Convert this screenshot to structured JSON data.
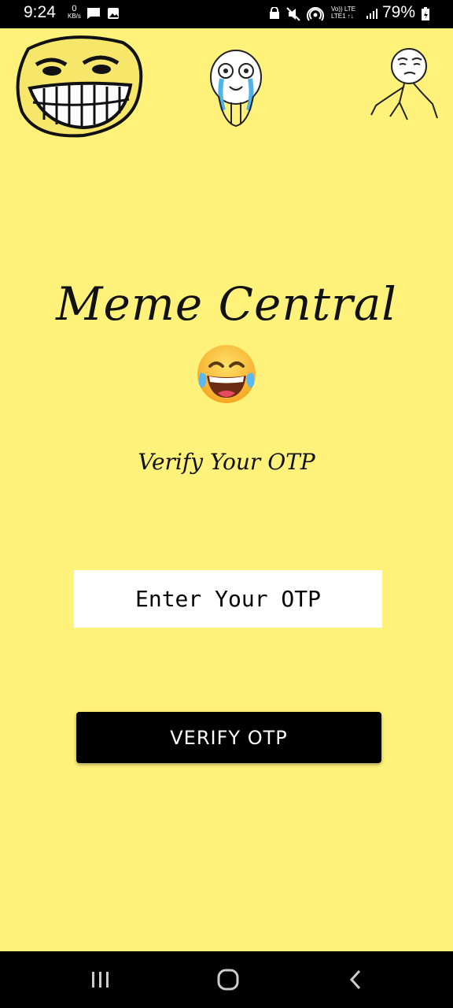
{
  "status_bar": {
    "time": "9:24",
    "net_speed_value": "0",
    "net_speed_unit": "KB/s",
    "lte_top": "Vo)) LTE",
    "lte_bottom": "LTE1 ↑↓",
    "battery": "79%"
  },
  "header_memes": [
    "troll-face",
    "crying-happy-rage-face",
    "okay-rage-face"
  ],
  "app": {
    "title": "Meme Central",
    "title_emoji": "😂",
    "subtitle": "Verify Your OTP",
    "otp_placeholder": "Enter Your OTP",
    "otp_value": "",
    "verify_button": "VERIFY OTP"
  },
  "colors": {
    "background": "#FFF27A",
    "button": "#000000",
    "input": "#FFFFFF"
  },
  "nav_bar": {
    "buttons": [
      "recent-apps",
      "home",
      "back"
    ]
  }
}
